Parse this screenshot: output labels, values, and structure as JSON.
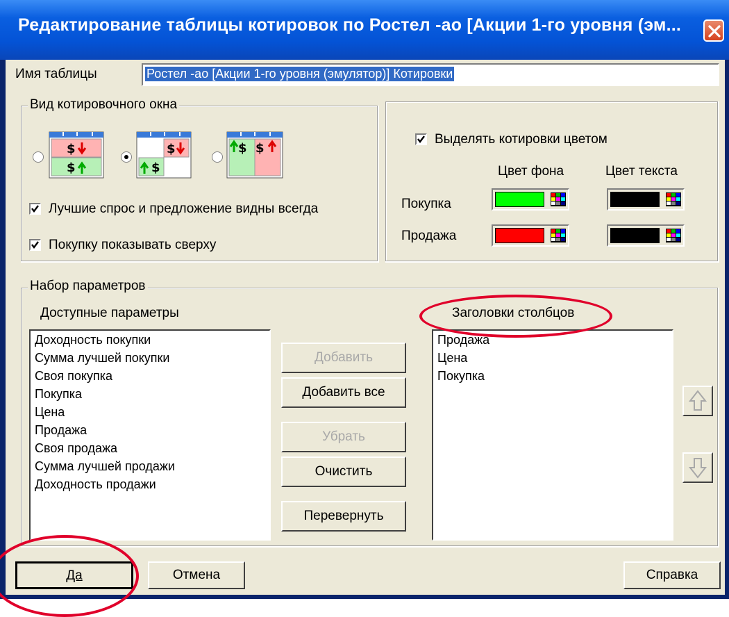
{
  "window": {
    "title": "Редактирование таблицы котировок по Ростел -ао [Акции 1-го уровня (эм...",
    "close_label": "×"
  },
  "table_name": {
    "label": "Имя таблицы",
    "value": "Ростел -ао [Акции 1-го уровня (эмулятор)] Котировки"
  },
  "view_group": {
    "title": "Вид котировочного окна",
    "radio_options": [
      {
        "name": "layout-stacked",
        "selected": false
      },
      {
        "name": "layout-diagonal",
        "selected": true
      },
      {
        "name": "layout-side-by-side",
        "selected": false
      }
    ],
    "best_always_visible": {
      "label": "Лучшие спрос и предложение видны всегда",
      "checked": true
    },
    "buy_on_top": {
      "label": "Покупку показывать сверху",
      "checked": true
    }
  },
  "color_group": {
    "highlight": {
      "label": "Выделять котировки цветом",
      "checked": true
    },
    "bg_header": "Цвет фона",
    "text_header": "Цвет текста",
    "rows": [
      {
        "label": "Покупка",
        "bg": "#00ff00",
        "text": "#000000"
      },
      {
        "label": "Продажа",
        "bg": "#ff0000",
        "text": "#000000"
      }
    ]
  },
  "params_group": {
    "title": "Набор параметров",
    "available_title": "Доступные параметры",
    "available": [
      "Доходность покупки",
      "Сумма лучшей покупки",
      "Своя покупка",
      "Покупка",
      "Цена",
      "Продажа",
      "Своя продажа",
      "Сумма лучшей продажи",
      "Доходность продажи"
    ],
    "columns_title": "Заголовки столбцов",
    "columns": [
      "Продажа",
      "Цена",
      "Покупка"
    ],
    "buttons": {
      "add": "Добавить",
      "add_all": "Добавить все",
      "remove": "Убрать",
      "clear": "Очистить",
      "reverse": "Перевернуть"
    }
  },
  "footer": {
    "ok": "Да",
    "cancel": "Отмена",
    "help": "Справка"
  },
  "colors": {
    "titlebar": "#0a5fe0",
    "dialog_bg": "#ece9d8",
    "highlight_ellipse": "#e0002a",
    "selection": "#316ac5"
  }
}
